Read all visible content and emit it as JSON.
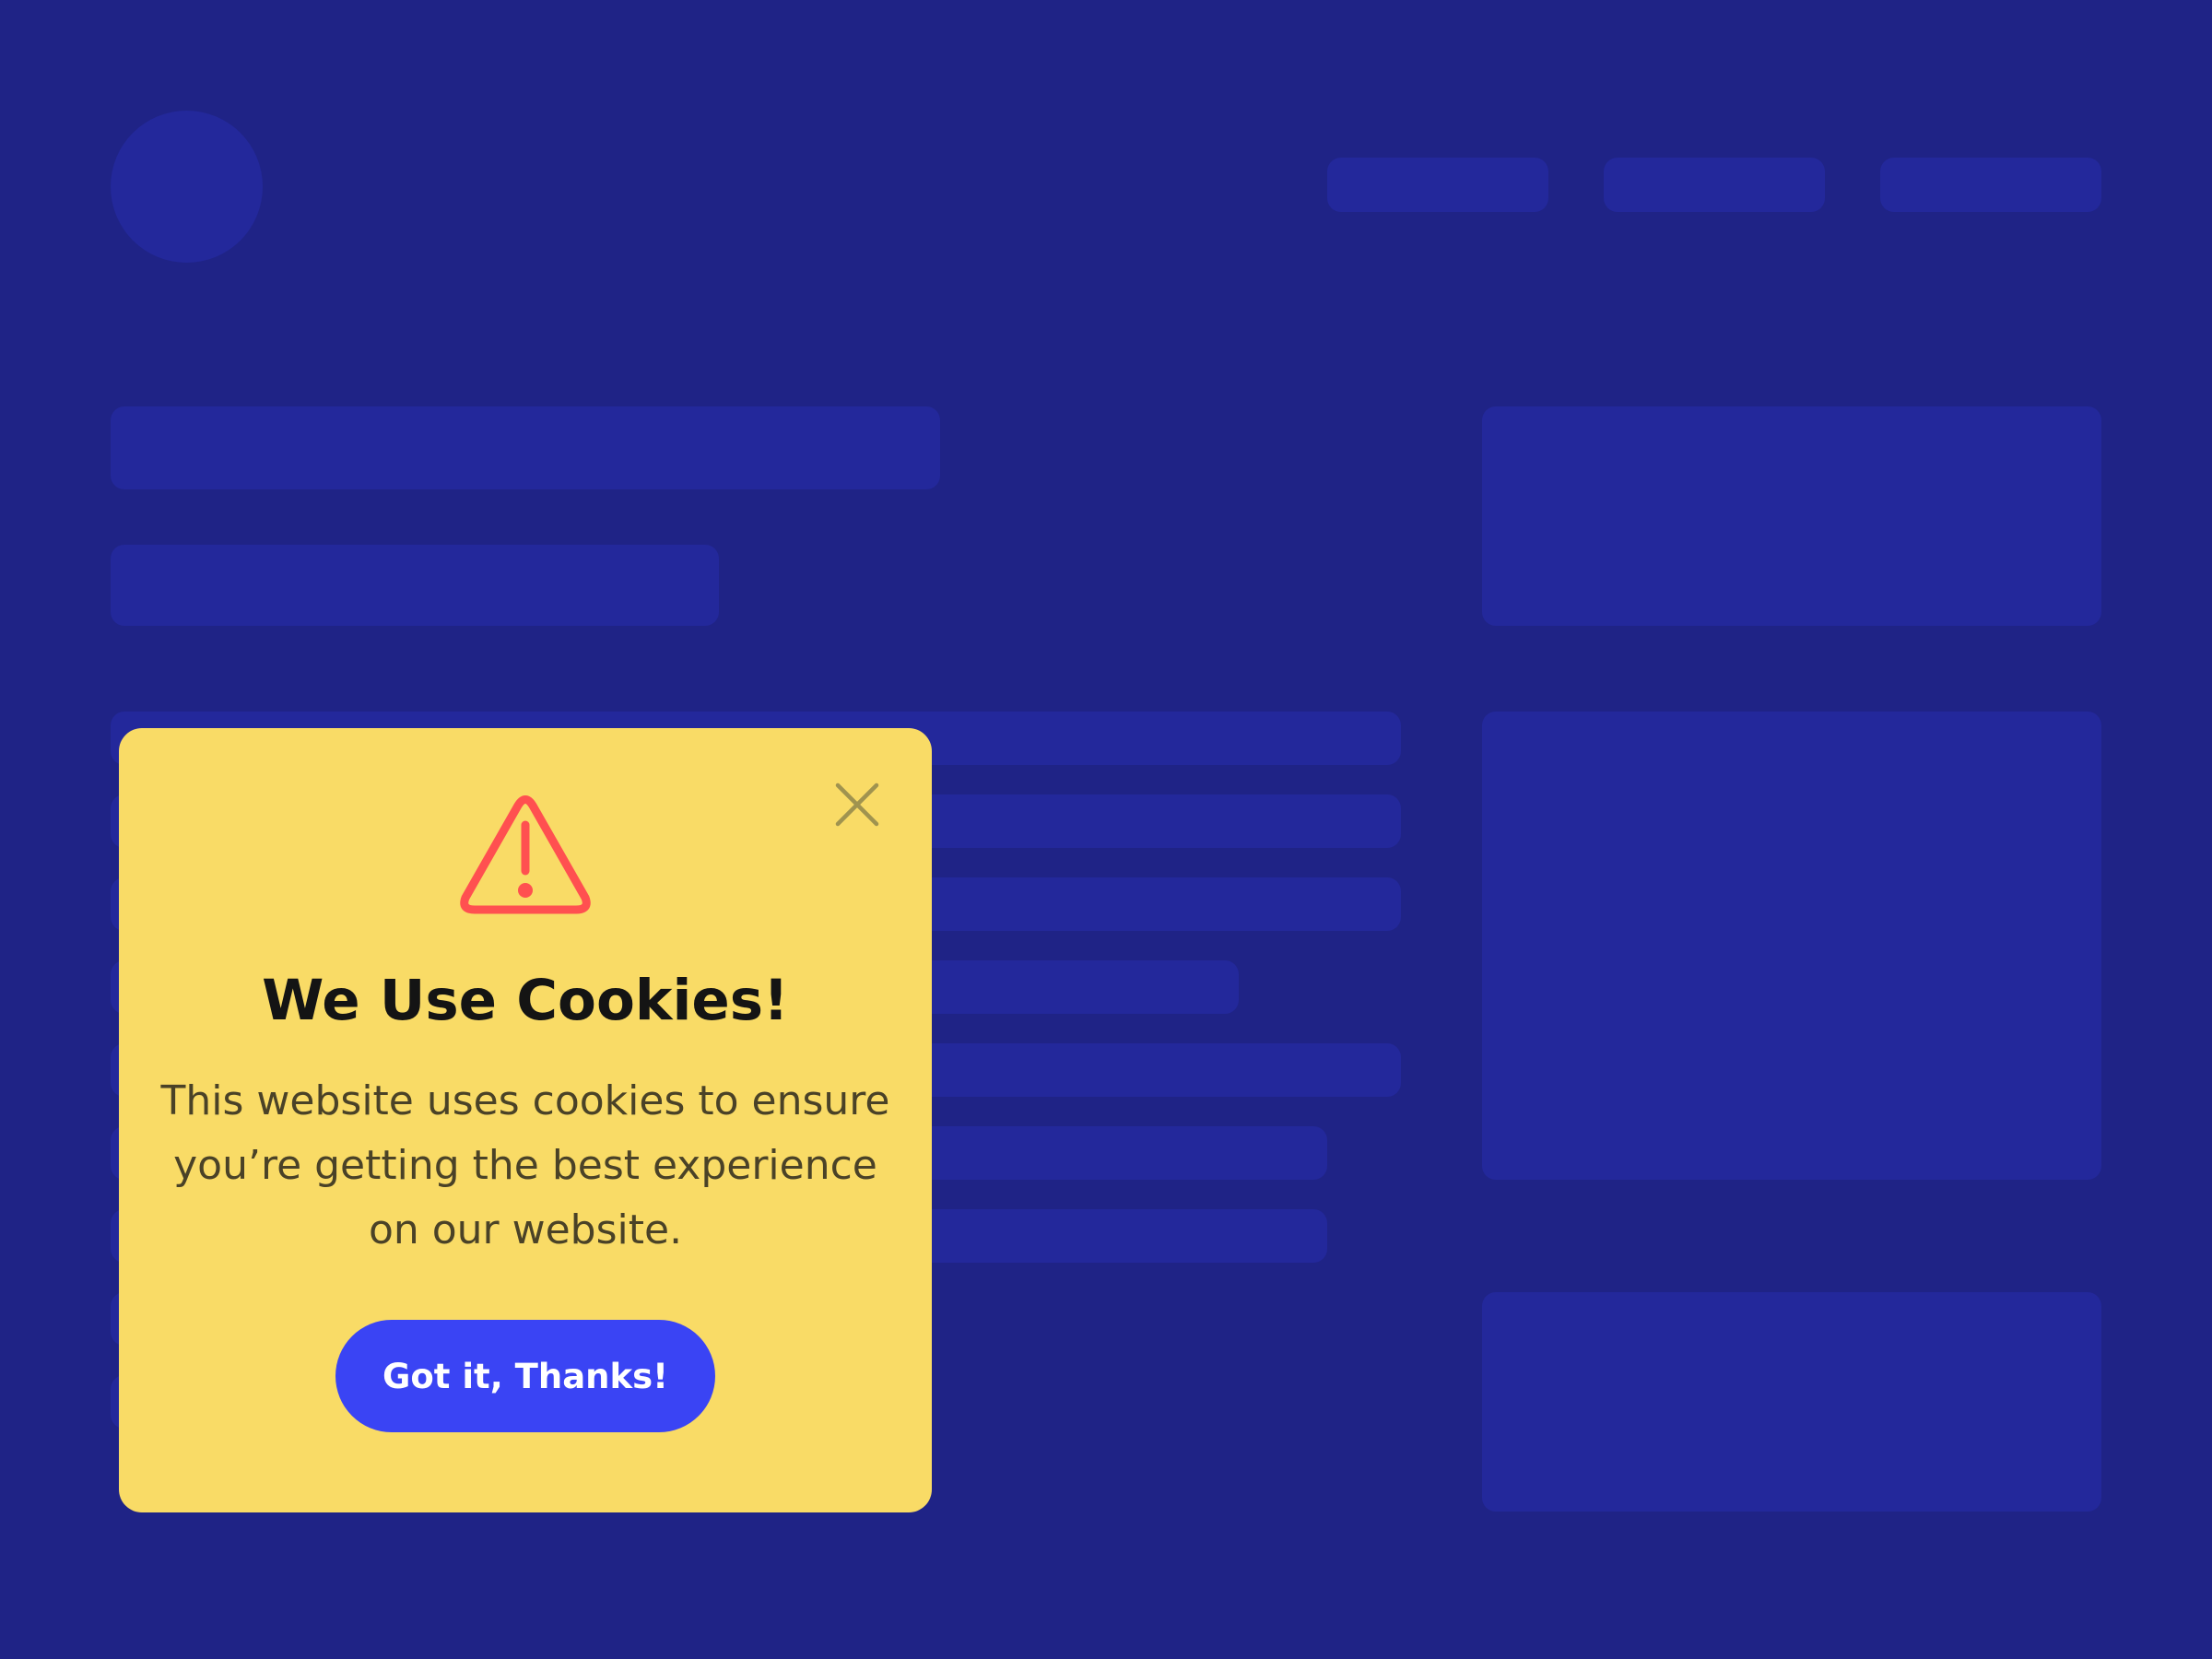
{
  "colors": {
    "background": "#1F2386",
    "placeholder": "#23289B",
    "popup_bg": "#F9DB66",
    "warning": "#FF5050",
    "close_icon": "#A0934F",
    "button_bg": "#3A44F4",
    "button_text": "#FFFFFF"
  },
  "icons": {
    "close": "close-icon",
    "warning": "warning-triangle-icon"
  },
  "cookie_popup": {
    "title": "We Use Cookies!",
    "message": "This website uses cookies to ensure you’re getting the best experience on our website.",
    "accept_label": "Got it, Thanks!"
  }
}
